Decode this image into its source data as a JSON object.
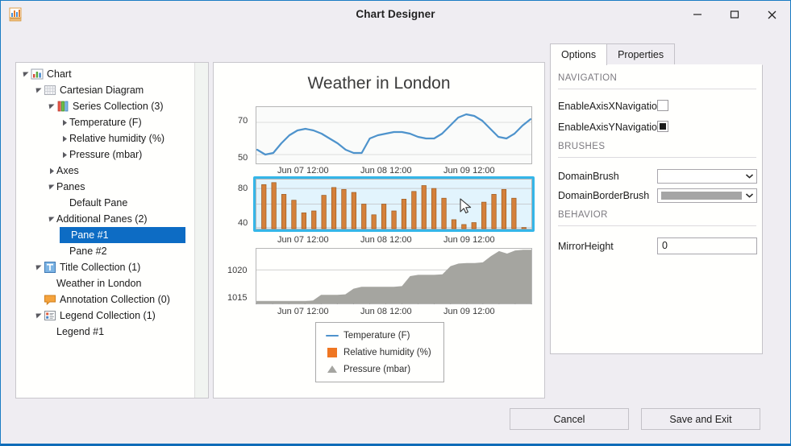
{
  "window": {
    "title": "Chart Designer",
    "app_icon": "bar-chart-ruler-icon",
    "minimize": "─",
    "maximize": "□",
    "close": "✕"
  },
  "toolbar": {
    "items": [
      {
        "name": "add-button",
        "icon": "add-circle-icon",
        "enabled": true
      },
      {
        "name": "undo-button",
        "icon": "undo-arrow-icon",
        "enabled": true
      },
      {
        "name": "redo-button",
        "icon": "redo-arrow-icon",
        "enabled": false
      },
      {
        "name": "chart-button",
        "icon": "chart-icon",
        "enabled": true
      }
    ]
  },
  "tree": {
    "nodes": [
      {
        "label": "Chart",
        "depth": 0,
        "twisty": "expanded",
        "icon": "chart-bars-icon",
        "selected": false
      },
      {
        "label": "Cartesian Diagram",
        "depth": 1,
        "twisty": "expanded",
        "icon": "grid-icon",
        "selected": false
      },
      {
        "label": "Series Collection (3)",
        "depth": 2,
        "twisty": "expanded",
        "icon": "series-bars-icon",
        "selected": false
      },
      {
        "label": "Temperature (F)",
        "depth": 3,
        "twisty": "collapsed",
        "icon": "none",
        "selected": false
      },
      {
        "label": "Relative humidity (%)",
        "depth": 3,
        "twisty": "collapsed",
        "icon": "none",
        "selected": false
      },
      {
        "label": "Pressure (mbar)",
        "depth": 3,
        "twisty": "collapsed",
        "icon": "none",
        "selected": false
      },
      {
        "label": "Axes",
        "depth": 2,
        "twisty": "collapsed",
        "icon": "none",
        "selected": false
      },
      {
        "label": "Panes",
        "depth": 2,
        "twisty": "expanded",
        "icon": "none",
        "selected": false
      },
      {
        "label": "Default Pane",
        "depth": 3,
        "twisty": "none",
        "icon": "none",
        "selected": false
      },
      {
        "label": "Additional Panes (2)",
        "depth": 2,
        "twisty": "expanded",
        "icon": "none",
        "selected": false
      },
      {
        "label": "Pane #1",
        "depth": 3,
        "twisty": "none",
        "icon": "none",
        "selected": true
      },
      {
        "label": "Pane #2",
        "depth": 3,
        "twisty": "none",
        "icon": "none",
        "selected": false
      },
      {
        "label": "Title Collection (1)",
        "depth": 1,
        "twisty": "expanded",
        "icon": "title-t-icon",
        "selected": false
      },
      {
        "label": "Weather in London",
        "depth": 2,
        "twisty": "none",
        "icon": "none",
        "selected": false
      },
      {
        "label": "Annotation Collection (0)",
        "depth": 1,
        "twisty": "none",
        "icon": "annotation-icon",
        "selected": false
      },
      {
        "label": "Legend Collection (1)",
        "depth": 1,
        "twisty": "expanded",
        "icon": "legend-icon",
        "selected": false
      },
      {
        "label": "Legend #1",
        "depth": 2,
        "twisty": "none",
        "icon": "none",
        "selected": false
      }
    ],
    "selection_color": "#0d6cc4"
  },
  "chart_data": [
    {
      "type": "line",
      "title": "Weather in London",
      "series_name": "Temperature (F)",
      "color": "#4e93cc",
      "ylabel": "",
      "xlabel": "",
      "yticks": [
        50,
        70
      ],
      "ylim": [
        44,
        80
      ],
      "xticks": [
        "Jun 07 12:00",
        "Jun 08 12:00",
        "Jun 09 12:00"
      ],
      "values": [
        53,
        50,
        51,
        57,
        62,
        65,
        66,
        65,
        63,
        60,
        57,
        53,
        51,
        51,
        60,
        62,
        63,
        64,
        64,
        63,
        61,
        60,
        60,
        63,
        68,
        73,
        75,
        74,
        71,
        66,
        61,
        60,
        63,
        68,
        72
      ]
    },
    {
      "type": "bar",
      "title": "",
      "series_name": "Relative humidity (%)",
      "color": "#d4803a",
      "ylabel": "",
      "xlabel": "",
      "yticks": [
        40,
        80
      ],
      "ylim": [
        38,
        90
      ],
      "xticks": [
        "Jun 07 12:00",
        "Jun 08 12:00",
        "Jun 09 12:00"
      ],
      "values": [
        84,
        86,
        74,
        68,
        55,
        57,
        73,
        81,
        79,
        76,
        64,
        53,
        64,
        57,
        69,
        77,
        83,
        80,
        70,
        48,
        43,
        45,
        66,
        74,
        79,
        70,
        40
      ],
      "selected_pane": true,
      "selection_border_color": "#35b6e8",
      "selection_fill_color": "#e2f4fd"
    },
    {
      "type": "area",
      "title": "",
      "series_name": "Pressure (mbar)",
      "color": "#a5a5a0",
      "ylabel": "",
      "xlabel": "",
      "yticks": [
        1015,
        1020
      ],
      "ylim": [
        1014.5,
        1023.5
      ],
      "xticks": [
        "Jun 07 12:00",
        "Jun 08 12:00",
        "Jun 09 12:00"
      ],
      "values": [
        1015,
        1015,
        1015,
        1015,
        1015,
        1015,
        1015,
        1015.1,
        1016,
        1016,
        1016,
        1016.1,
        1017,
        1017.3,
        1017.3,
        1017.3,
        1017.3,
        1017.3,
        1017.4,
        1019,
        1019.2,
        1019.2,
        1019.2,
        1019.3,
        1020.6,
        1021,
        1021.1,
        1021.1,
        1021.2,
        1022.2,
        1023,
        1022.6,
        1023.1,
        1023.2,
        1023.2
      ]
    }
  ],
  "legend": {
    "items": [
      {
        "label": "Temperature (F)",
        "marker": "line-marker",
        "color": "#4e93cc"
      },
      {
        "label": "Relative humidity (%)",
        "marker": "square-marker",
        "color": "#ef7622"
      },
      {
        "label": "Pressure (mbar)",
        "marker": "triangle-marker",
        "color": "#a5a5a0"
      }
    ]
  },
  "options": {
    "tabs": [
      {
        "label": "Options",
        "active": true
      },
      {
        "label": "Properties",
        "active": false
      }
    ],
    "sections": [
      {
        "header": "NAVIGATION",
        "rows": [
          {
            "label": "EnableAxisXNavigation",
            "type": "checkbox",
            "checked": false
          },
          {
            "label": "EnableAxisYNavigation",
            "type": "checkbox",
            "checked": true
          }
        ]
      },
      {
        "header": "BRUSHES",
        "rows": [
          {
            "label": "DomainBrush",
            "type": "brush-combo",
            "value": "#ffffff"
          },
          {
            "label": "DomainBorderBrush",
            "type": "brush-combo",
            "value": "#a5a5a5"
          }
        ]
      },
      {
        "header": "BEHAVIOR",
        "rows": [
          {
            "label": "MirrorHeight",
            "type": "text",
            "value": "0"
          }
        ]
      }
    ]
  },
  "footer": {
    "cancel_label": "Cancel",
    "save_label": "Save and Exit"
  }
}
